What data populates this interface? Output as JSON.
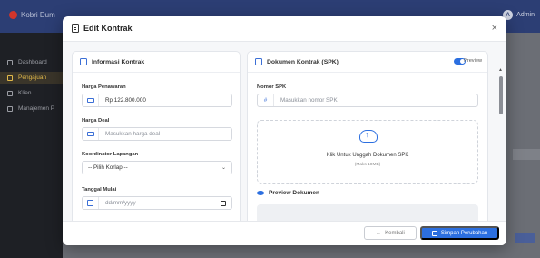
{
  "app": {
    "brand": "Kobri Dum",
    "user_initial": "A",
    "user_name": "Admin"
  },
  "sidebar": {
    "items": [
      {
        "label": "Dashboard"
      },
      {
        "label": "Pengajuan"
      },
      {
        "label": "Klien"
      },
      {
        "label": "Manajemen P"
      }
    ]
  },
  "modal": {
    "title": "Edit Kontrak",
    "close": "×",
    "left_card": {
      "title": "Informasi Kontrak",
      "fields": [
        {
          "label": "Harga Penawaran",
          "value": "Rp 122.800.000",
          "placeholder": ""
        },
        {
          "label": "Harga Deal",
          "value": "",
          "placeholder": "Masukkan harga deal"
        },
        {
          "label": "Koordinator Lapangan",
          "value": "-- Pilih Korlap --",
          "placeholder": ""
        },
        {
          "label": "Tanggal Mulai",
          "value": "",
          "placeholder": "dd/mm/yyyy"
        }
      ]
    },
    "right_card": {
      "title": "Dokumen Kontrak (SPK)",
      "preview_toggle_label": "Preview",
      "preview_on": true,
      "spk_label": "Nomor SPK",
      "spk_addon": "#",
      "spk_placeholder": "Masukkan nomor SPK",
      "upload_text": "Klik Untuk Unggah Dokumen SPK",
      "upload_sub": "(Maks 10MB)",
      "preview_title": "Preview Dokumen"
    },
    "footer": {
      "back_label": "Kembali",
      "save_label": "Simpan Perubahan"
    }
  },
  "colors": {
    "primary": "#2c6fe0",
    "sidebar_active": "#e0b84a",
    "topbar": "#2c3e74"
  }
}
